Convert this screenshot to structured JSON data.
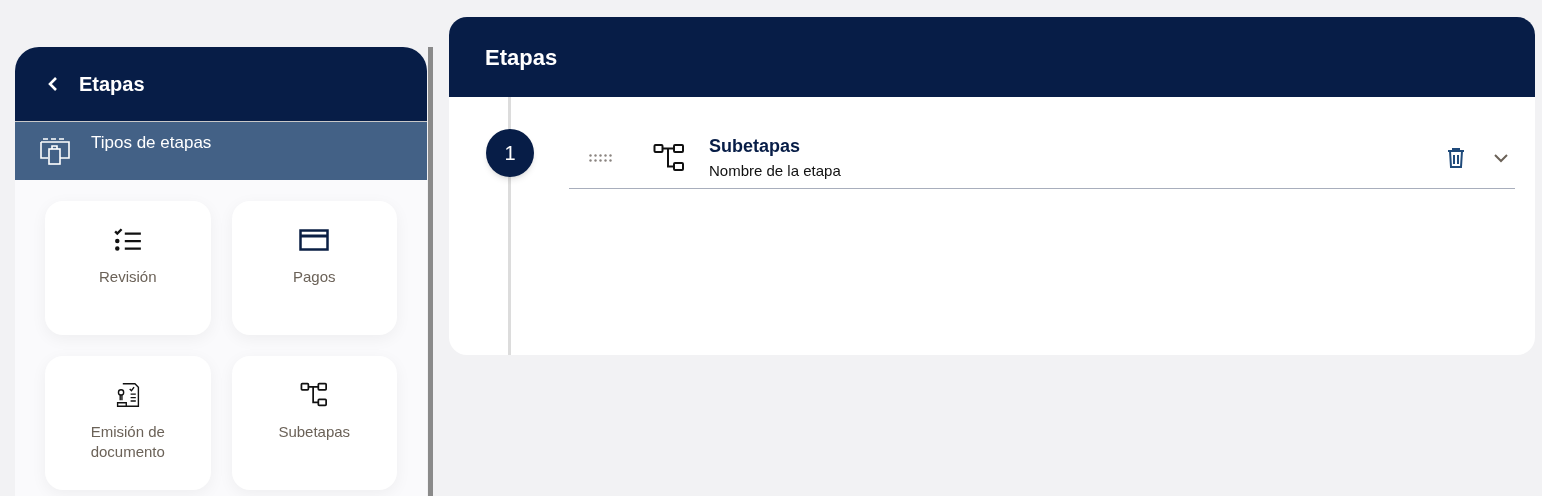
{
  "sidebar": {
    "title": "Etapas",
    "section": {
      "label": "Tipos de etapas",
      "selected": true
    },
    "cards": [
      {
        "kind": "checklist",
        "label": "Revisión"
      },
      {
        "kind": "card",
        "label": "Pagos"
      },
      {
        "kind": "stamp",
        "label": "Emisión de documento"
      },
      {
        "kind": "tree",
        "label": "Subetapas"
      }
    ]
  },
  "main": {
    "title": "Etapas",
    "stages": [
      {
        "number": "1",
        "kind": "tree",
        "title": "Subetapas",
        "subtitle": "Nombre de la etapa",
        "expanded": false
      }
    ]
  }
}
